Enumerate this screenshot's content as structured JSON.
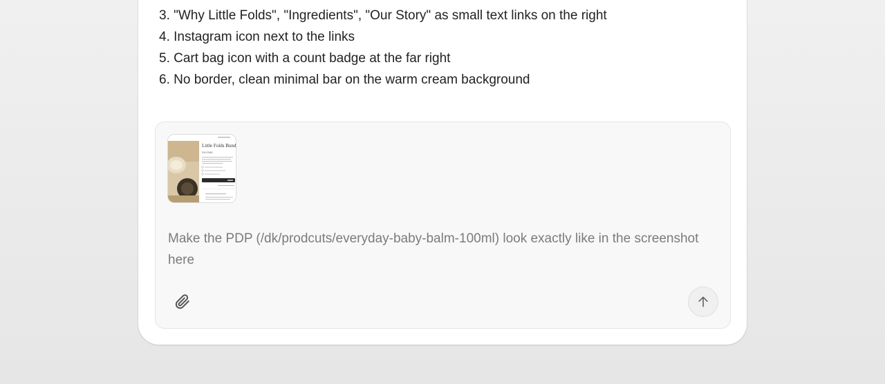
{
  "message": {
    "items": [
      "3. \"Why Little Folds\", \"Ingredients\", \"Our Story\" as small text links on the right",
      "4. Instagram icon next to the links",
      "5. Cart bag icon with a count badge at the far right",
      "6. No border, clean minimal bar on the warm cream background"
    ]
  },
  "composer": {
    "text": "Make the PDP (/dk/prodcuts/everyday-baby-balm-100ml) look exactly like in the screenshot here",
    "attachment": {
      "title": "Little Folds Bundl",
      "price": "310 DKK"
    },
    "attach_icon": "paperclip-icon",
    "send_icon": "arrow-up-icon"
  },
  "colors": {
    "background": "#ececec",
    "card": "#ffffff",
    "composer_bg": "#f8f8f8",
    "text": "#222222",
    "placeholder_text": "#7b7b7b",
    "icon": "#666666"
  }
}
